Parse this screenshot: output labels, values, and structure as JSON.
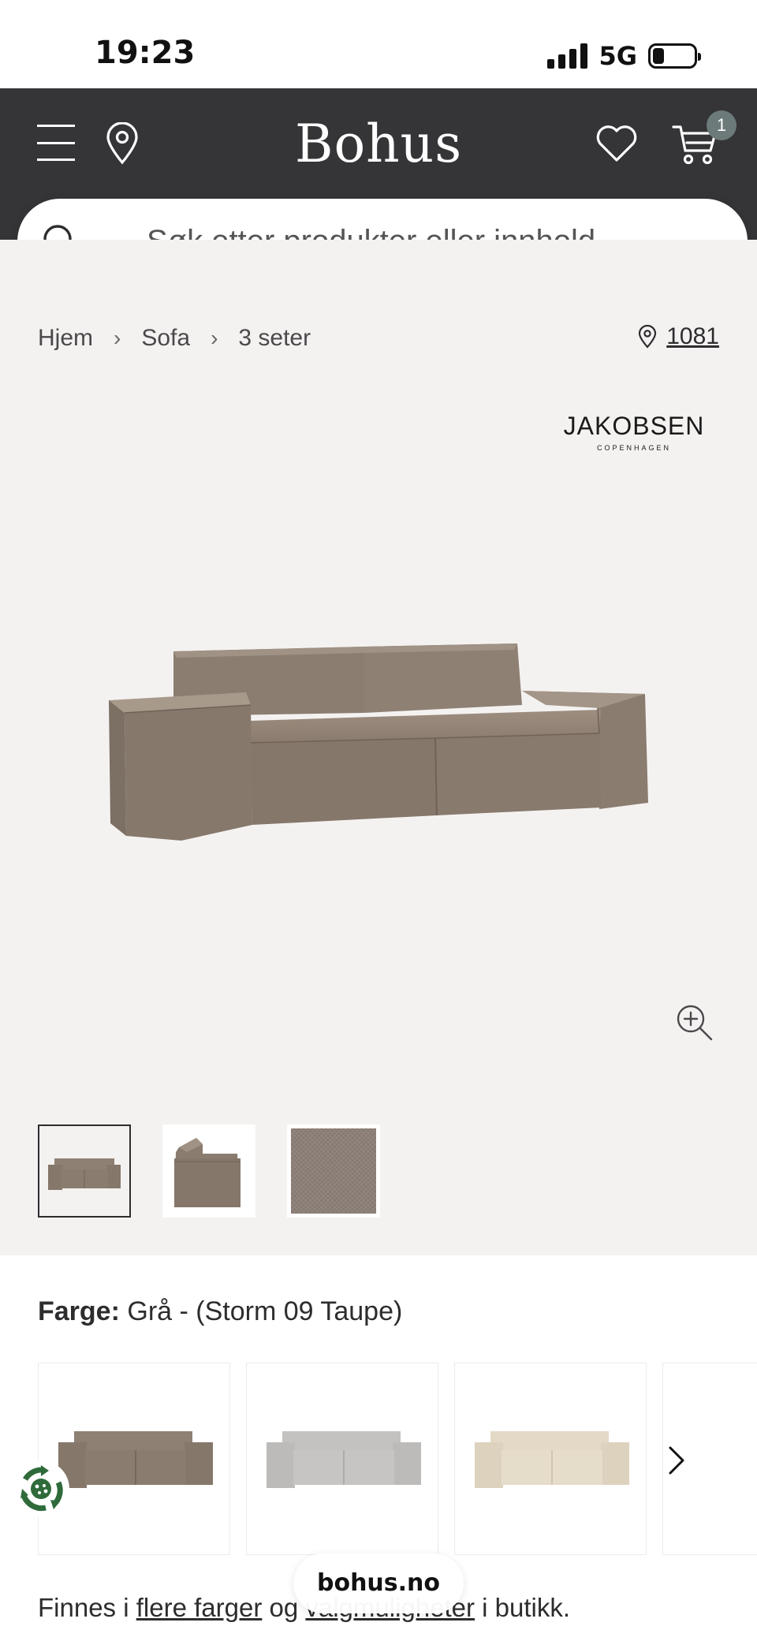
{
  "status_bar": {
    "time": "19:23",
    "network": "5G"
  },
  "header": {
    "logo": "Bohus",
    "cart_count": "1"
  },
  "search": {
    "placeholder": "Søk etter produkter eller innhold ..."
  },
  "breadcrumb": [
    "Hjem",
    "Sofa",
    "3 seter"
  ],
  "store": {
    "code": "1081"
  },
  "brand": {
    "name": "JAKOBSEN",
    "sub": "COPENHAGEN"
  },
  "color": {
    "label": "Farge:",
    "value": "Grå - (Storm 09 Taupe)"
  },
  "color_options": [
    {
      "hex": "#8c7d70"
    },
    {
      "hex": "#c7c6c5"
    },
    {
      "hex": "#e6dcca"
    }
  ],
  "availability": {
    "prefix": "Finnes i",
    "link1": "flere farger",
    "middle": "og",
    "link2": "valgmuligheter",
    "suffix": "i butikk."
  },
  "url_bar": {
    "domain": "bohus.no"
  },
  "colors": {
    "header_bg": "#353437",
    "media_bg": "#f4f2f1",
    "badge_bg": "#6c7a7a",
    "sofa": "#8c7d70"
  }
}
